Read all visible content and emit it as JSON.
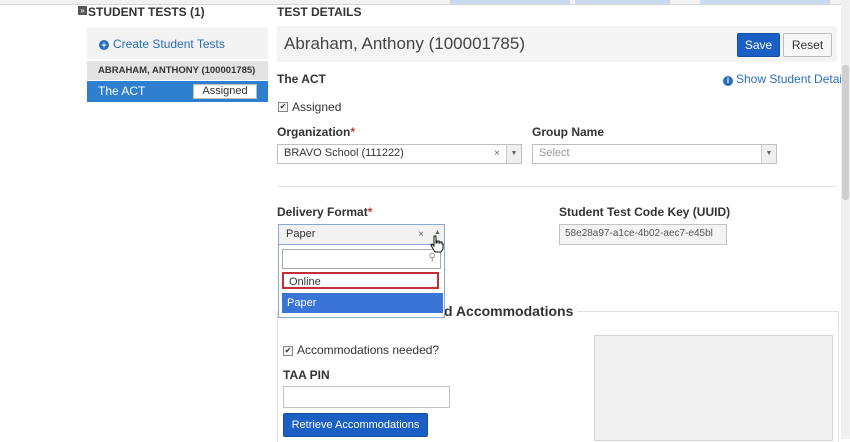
{
  "left": {
    "title": "STUDENT TESTS (1)",
    "create_label": "Create Student Tests",
    "student_label": "ABRAHAM, ANTHONY (100001785)",
    "test": {
      "name": "The ACT",
      "status": "Assigned"
    }
  },
  "right": {
    "title": "TEST DETAILS",
    "student_name": "Abraham, Anthony (100001785)",
    "save_label": "Save",
    "reset_label": "Reset",
    "test_name": "The ACT",
    "show_details_label": "Show Student Details",
    "assigned_label": "Assigned",
    "assigned_checked": true,
    "organization": {
      "label": "Organization",
      "required_mark": "*",
      "value": "BRAVO School (111222)"
    },
    "group": {
      "label": "Group Name",
      "placeholder": "Select"
    },
    "delivery": {
      "label": "Delivery Format",
      "required_mark": "*",
      "value": "Paper",
      "options": [
        "Online",
        "Paper"
      ],
      "highlighted": "Paper"
    },
    "uuid": {
      "label": "Student Test Code Key (UUID)",
      "value": "58e28a97-a1ce-4b02-aec7-e45bl"
    },
    "accommodations": {
      "legend": "d Accommodations",
      "needed_label": "Accommodations needed?",
      "needed_checked": true,
      "taa_pin_label": "TAA PIN",
      "retrieve_label": "Retrieve Accommodations"
    }
  },
  "icons": {
    "plus": "+",
    "info": "i",
    "clear": "×",
    "caret_down": "▼",
    "caret_up": "▲",
    "check": "✔",
    "search": "⚲",
    "expand": "»"
  },
  "colors": {
    "primary": "#1b5fc4",
    "selected_row": "#2f7fd0",
    "link": "#2a6eb8",
    "highlight_border": "#c0303a",
    "option_highlight": "#3875d7"
  }
}
